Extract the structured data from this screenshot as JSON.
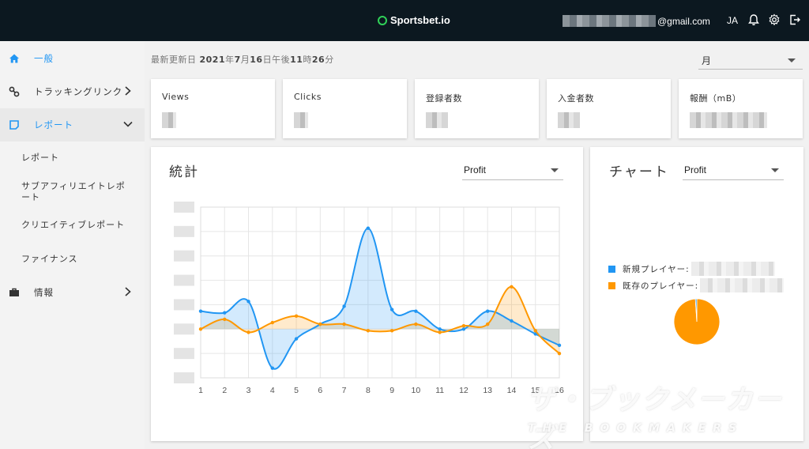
{
  "header": {
    "logo_text": "Sportsbet.io",
    "email_suffix": "@gmail.com",
    "language": "JA"
  },
  "sidebar": {
    "items": [
      {
        "label": "一般",
        "icon": "home-icon"
      },
      {
        "label": "トラッキングリンク",
        "icon": "link-icon"
      },
      {
        "label": "レポート",
        "icon": "report-icon"
      },
      {
        "label": "情報",
        "icon": "briefcase-icon"
      }
    ],
    "sub_items": [
      {
        "label": "レポート"
      },
      {
        "label": "サブアフィリエイトレポート"
      },
      {
        "label": "クリエイティブレポート"
      },
      {
        "label": "ファイナンス"
      }
    ]
  },
  "main": {
    "updated_label": "最新更新日",
    "updated_year": "2021",
    "updated_year_unit": "年",
    "updated_month": "7",
    "updated_month_unit": "月",
    "updated_day": "16",
    "updated_day_unit": "日",
    "updated_ampm": "午後",
    "updated_hour": "11",
    "updated_hour_unit": "時",
    "updated_min": "26",
    "updated_min_unit": "分",
    "period_value": "月"
  },
  "cards": [
    {
      "label": "Views"
    },
    {
      "label": "Clicks"
    },
    {
      "label": "登録者数"
    },
    {
      "label": "入金者数"
    },
    {
      "label": "報酬（mB）"
    }
  ],
  "stats_panel": {
    "title": "統計",
    "select_value": "Profit"
  },
  "chart_panel": {
    "title": "チャート",
    "select_value": "Profit",
    "legend": [
      {
        "label": "新規プレイヤー:",
        "color": "#2196f3"
      },
      {
        "label": "既存のプレイヤー:",
        "color": "#ff9800"
      }
    ]
  },
  "chart_data": {
    "type": "line",
    "x": [
      1,
      2,
      3,
      4,
      5,
      6,
      7,
      8,
      9,
      10,
      11,
      12,
      13,
      14,
      15,
      16
    ],
    "series": [
      {
        "color": "#2196f3",
        "values": [
          1.1,
          1.0,
          1.7,
          -2.4,
          -0.6,
          0.3,
          1.4,
          6.2,
          1.2,
          1.1,
          0.0,
          0.0,
          1.1,
          0.5,
          -0.3,
          -1.0
        ]
      },
      {
        "color": "#ff9800",
        "values": [
          0.0,
          0.6,
          -0.2,
          0.4,
          0.8,
          0.3,
          0.3,
          -0.1,
          -0.1,
          0.3,
          -0.2,
          0.2,
          0.3,
          2.6,
          -0.1,
          -1.5
        ]
      }
    ],
    "ylim": [
      -3,
      7.5
    ],
    "grid": true,
    "legend": "none"
  },
  "pie_data": {
    "type": "pie",
    "slices": [
      {
        "value": 99,
        "color": "#ff9800"
      },
      {
        "value": 1,
        "color": "#2196f3"
      }
    ]
  },
  "watermark": {
    "main": "ザ・ブックメーカーズ",
    "sub": "THE BOOKMAKERS"
  },
  "colors": {
    "topbar": "#0c1820",
    "accent": "#2196f3",
    "orange": "#ff9800"
  }
}
